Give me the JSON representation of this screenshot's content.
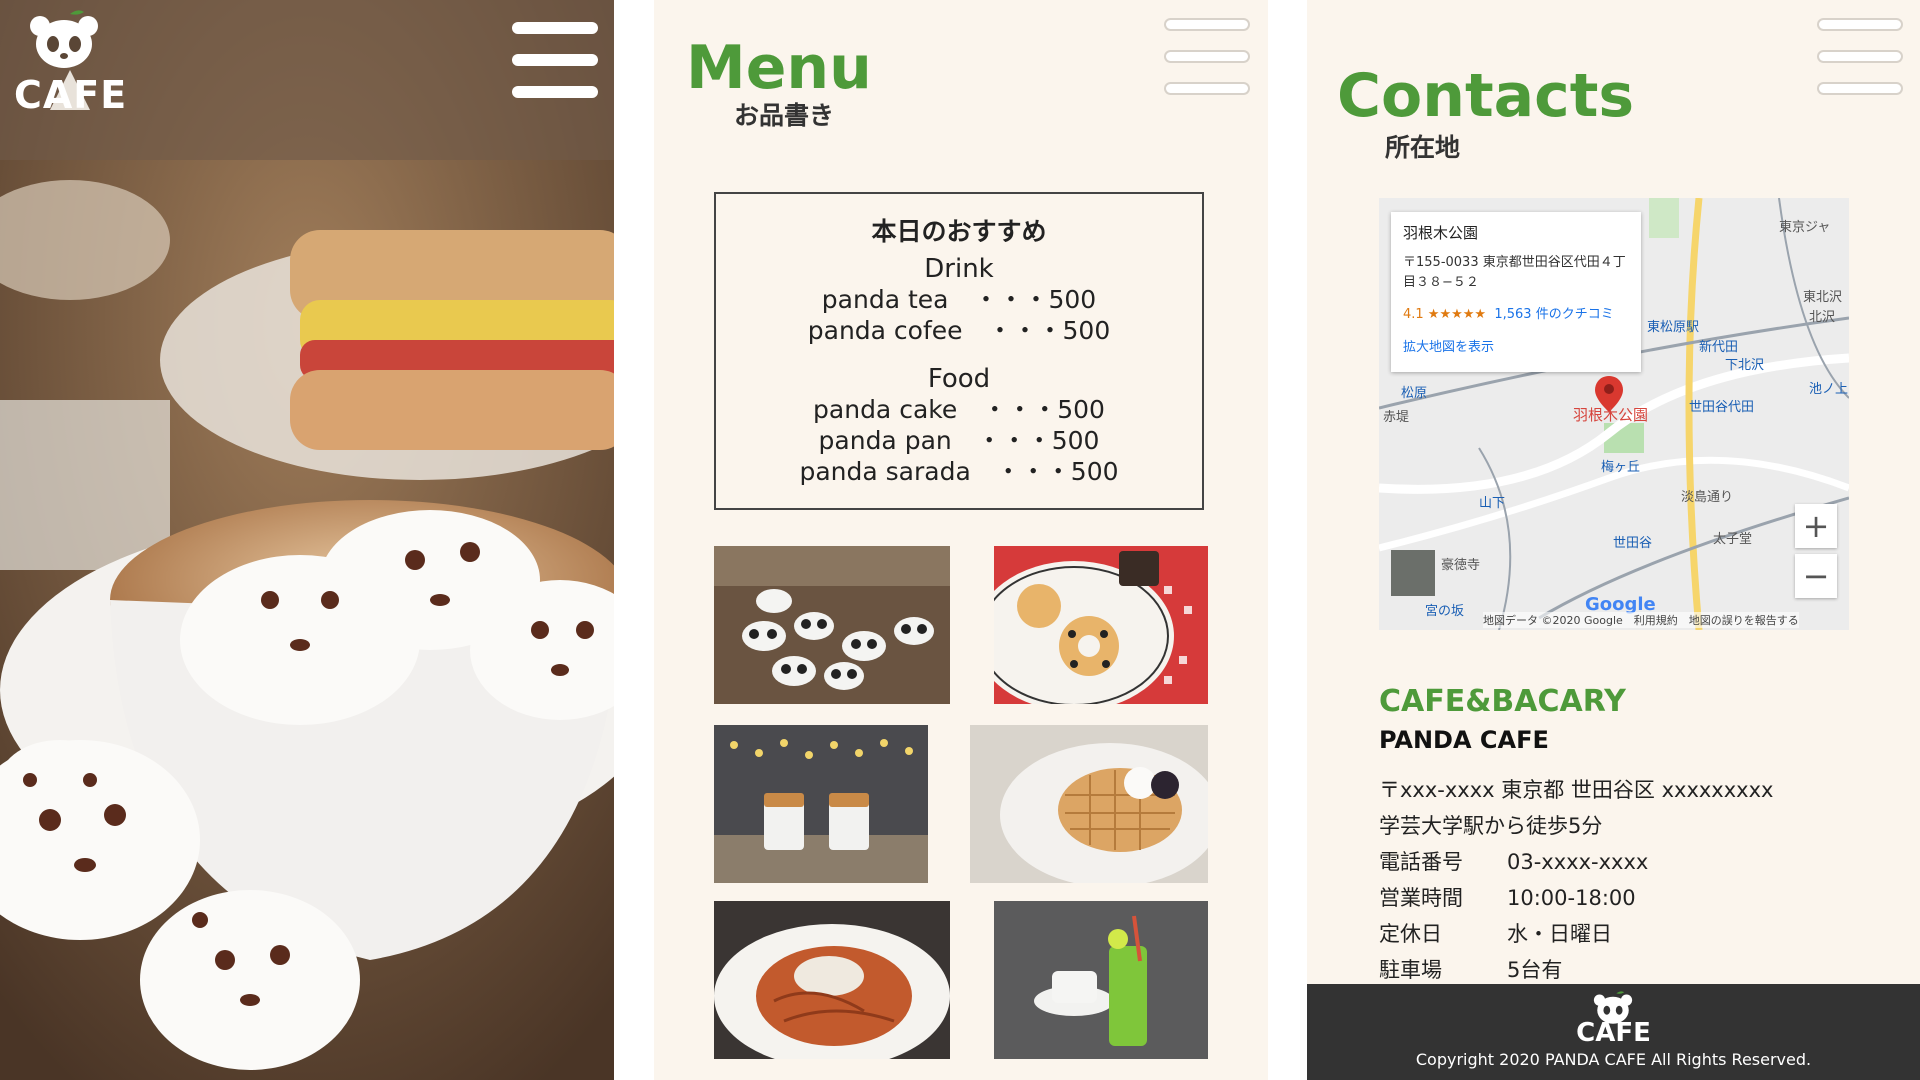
{
  "hero": {
    "logo_text": "CAFE"
  },
  "menu_page": {
    "title": "Menu",
    "subtitle": "お品書き",
    "box": {
      "heading": "本日のおすすめ",
      "sections": [
        {
          "category": "Drink",
          "items": [
            "panda tea　・・・500",
            "panda cofee　・・・500"
          ]
        },
        {
          "category": "Food",
          "items": [
            "panda cake　・・・500",
            "panda pan　・・・500",
            "panda sarada　・・・500"
          ]
        }
      ]
    },
    "photos": [
      "panda-figurines-photo",
      "panda-donut-photo",
      "drinks-with-lights-photo",
      "waffle-photo",
      "pasta-photo",
      "green-drink-coffee-photo"
    ]
  },
  "contacts_page": {
    "title": "Contacts",
    "subtitle": "所在地",
    "map": {
      "place_name": "羽根木公園",
      "address_line1": "〒155-0033 東京都世田谷区代田４丁",
      "address_line2": "目３８−５２",
      "rating": "4.1 ★★★★★",
      "reviews": "1,563 件のクチコミ",
      "enlarge_link": "拡大地図を表示",
      "pin_label": "羽根木公園",
      "labels": {
        "tokyo": "東京ジャ",
        "higashikitazawa": "東北沢",
        "kitazawa": "北沢",
        "shimokitazawa_stn": "東松原駅",
        "shindaita": "新代田",
        "shimokitazawa": "下北沢",
        "ikenoue": "池ノ上",
        "matsubara": "松原",
        "akatsutsumi": "赤堤",
        "setagayadaita": "世田谷代田",
        "umegaoka": "梅ヶ丘",
        "yamashita": "山下",
        "setagaya": "世田谷",
        "taishido": "太子堂",
        "gotokuji": "豪徳寺",
        "miyanosaka": "宮の坂",
        "awashima": "淡島通り"
      },
      "zoom_in": "+",
      "zoom_out": "−",
      "google": "Google",
      "attribution": "地図データ ©2020 Google　利用規約　地図の誤りを報告する"
    },
    "cafe_heading": "CAFE&BACARY",
    "cafe_name": "PANDA CAFE",
    "address": "〒xxx-xxxx 東京都 世田谷区 xxxxxxxxx",
    "access": "学芸大学駅から徒歩5分",
    "details": [
      {
        "key": "電話番号",
        "value": "03-xxxx-xxxx"
      },
      {
        "key": "営業時間",
        "value": "10:00-18:00"
      },
      {
        "key": "定休日",
        "value": "水・日曜日"
      },
      {
        "key": "駐車場",
        "value": "5台有"
      }
    ],
    "footer": {
      "logo_text": "CAFE",
      "copyright": "Copyright 2020 PANDA CAFE All Rights Reserved."
    }
  },
  "colors": {
    "accent_green": "#4e9a3a",
    "page_bg": "#fbf5ed",
    "footer_bg": "#333333"
  }
}
